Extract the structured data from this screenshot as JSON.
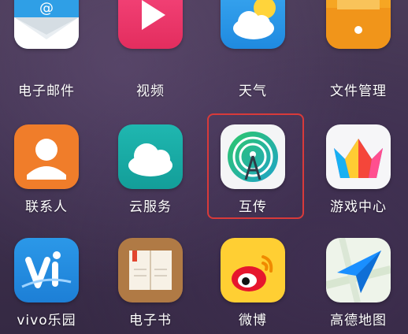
{
  "apps": [
    {
      "label": "电子邮件",
      "icon": "email-icon"
    },
    {
      "label": "视频",
      "icon": "video-play-icon"
    },
    {
      "label": "天气",
      "icon": "weather-icon"
    },
    {
      "label": "文件管理",
      "icon": "folder-icon"
    },
    {
      "label": "联系人",
      "icon": "contacts-icon"
    },
    {
      "label": "云服务",
      "icon": "cloud-icon"
    },
    {
      "label": "互传",
      "icon": "share-transfer-icon"
    },
    {
      "label": "游戏中心",
      "icon": "game-crown-icon"
    },
    {
      "label": "vivo乐园",
      "icon": "vivo-park-icon"
    },
    {
      "label": "电子书",
      "icon": "ebook-icon"
    },
    {
      "label": "微博",
      "icon": "weibo-icon"
    },
    {
      "label": "高德地图",
      "icon": "amap-icon"
    }
  ],
  "selected_app": "互传",
  "colors": {
    "highlight": "#d83a3a",
    "label": "#ffffff"
  }
}
